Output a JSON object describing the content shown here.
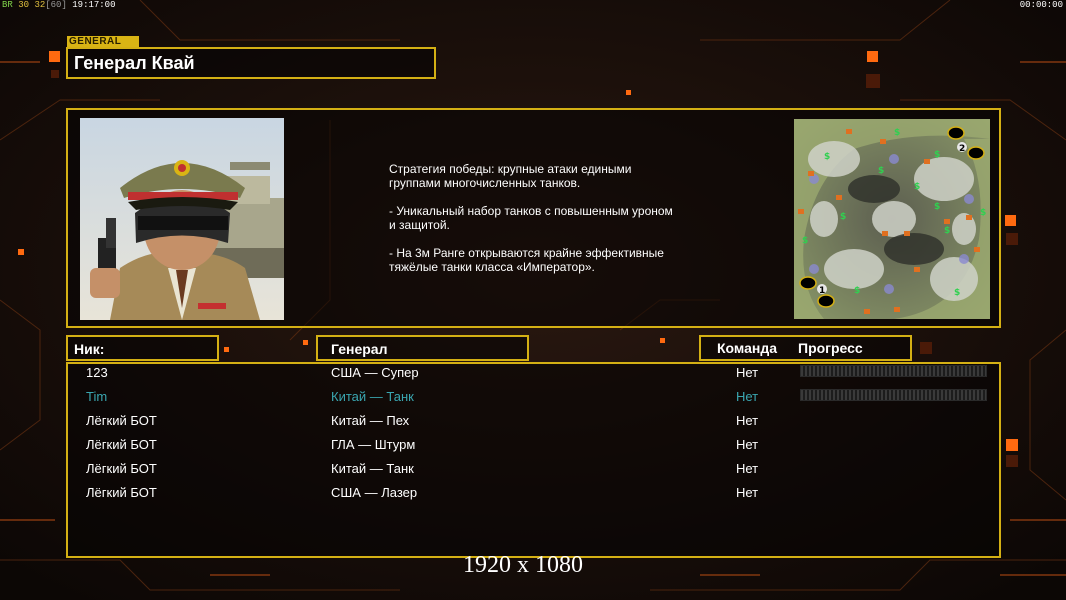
{
  "hud": {
    "stats_a": "BR",
    "stats_b": "30",
    "stats_c": "32",
    "stats_d": "[60]",
    "time_left": "19:17:00",
    "time_right": "00:00:00"
  },
  "general_tag": "GENERAL",
  "general_name": "Генерал Квай",
  "description": "Стратегия победы: крупные атаки едиными\n группами многочисленных танков.\n\n- Уникальный набор танков с повышенным уроном\n и защитой.\n\n- На 3м Ранге открываются крайне эффективные\n тяжёлые танки класса «Император».",
  "minimap": {
    "start_1": "1",
    "start_2": "2",
    "supply_icon": "dollar-icon"
  },
  "columns": {
    "nick": "Ник:",
    "general": "Генерал",
    "team": "Команда",
    "progress": "Прогресс"
  },
  "players": [
    {
      "nick": "123",
      "general": "США — Супер",
      "team": "Нет",
      "highlight": false,
      "has_progress": true,
      "progress": 0
    },
    {
      "nick": "Tim",
      "general": "Китай — Танк",
      "team": "Нет",
      "highlight": true,
      "has_progress": true,
      "progress": 0
    },
    {
      "nick": "Лёгкий БОТ",
      "general": "Китай — Пех",
      "team": "Нет",
      "highlight": false,
      "has_progress": false
    },
    {
      "nick": "Лёгкий БОТ",
      "general": "ГЛА — Штурм",
      "team": "Нет",
      "highlight": false,
      "has_progress": false
    },
    {
      "nick": "Лёгкий БОТ",
      "general": "Китай — Танк",
      "team": "Нет",
      "highlight": false,
      "has_progress": false
    },
    {
      "nick": "Лёгкий БОТ",
      "general": "США — Лазер",
      "team": "Нет",
      "highlight": false,
      "has_progress": false
    }
  ],
  "colors": {
    "frame": "#d4b014",
    "highlight": "#3aa6b0",
    "accent": "#ff6a10"
  },
  "resolution": "1920 x 1080"
}
